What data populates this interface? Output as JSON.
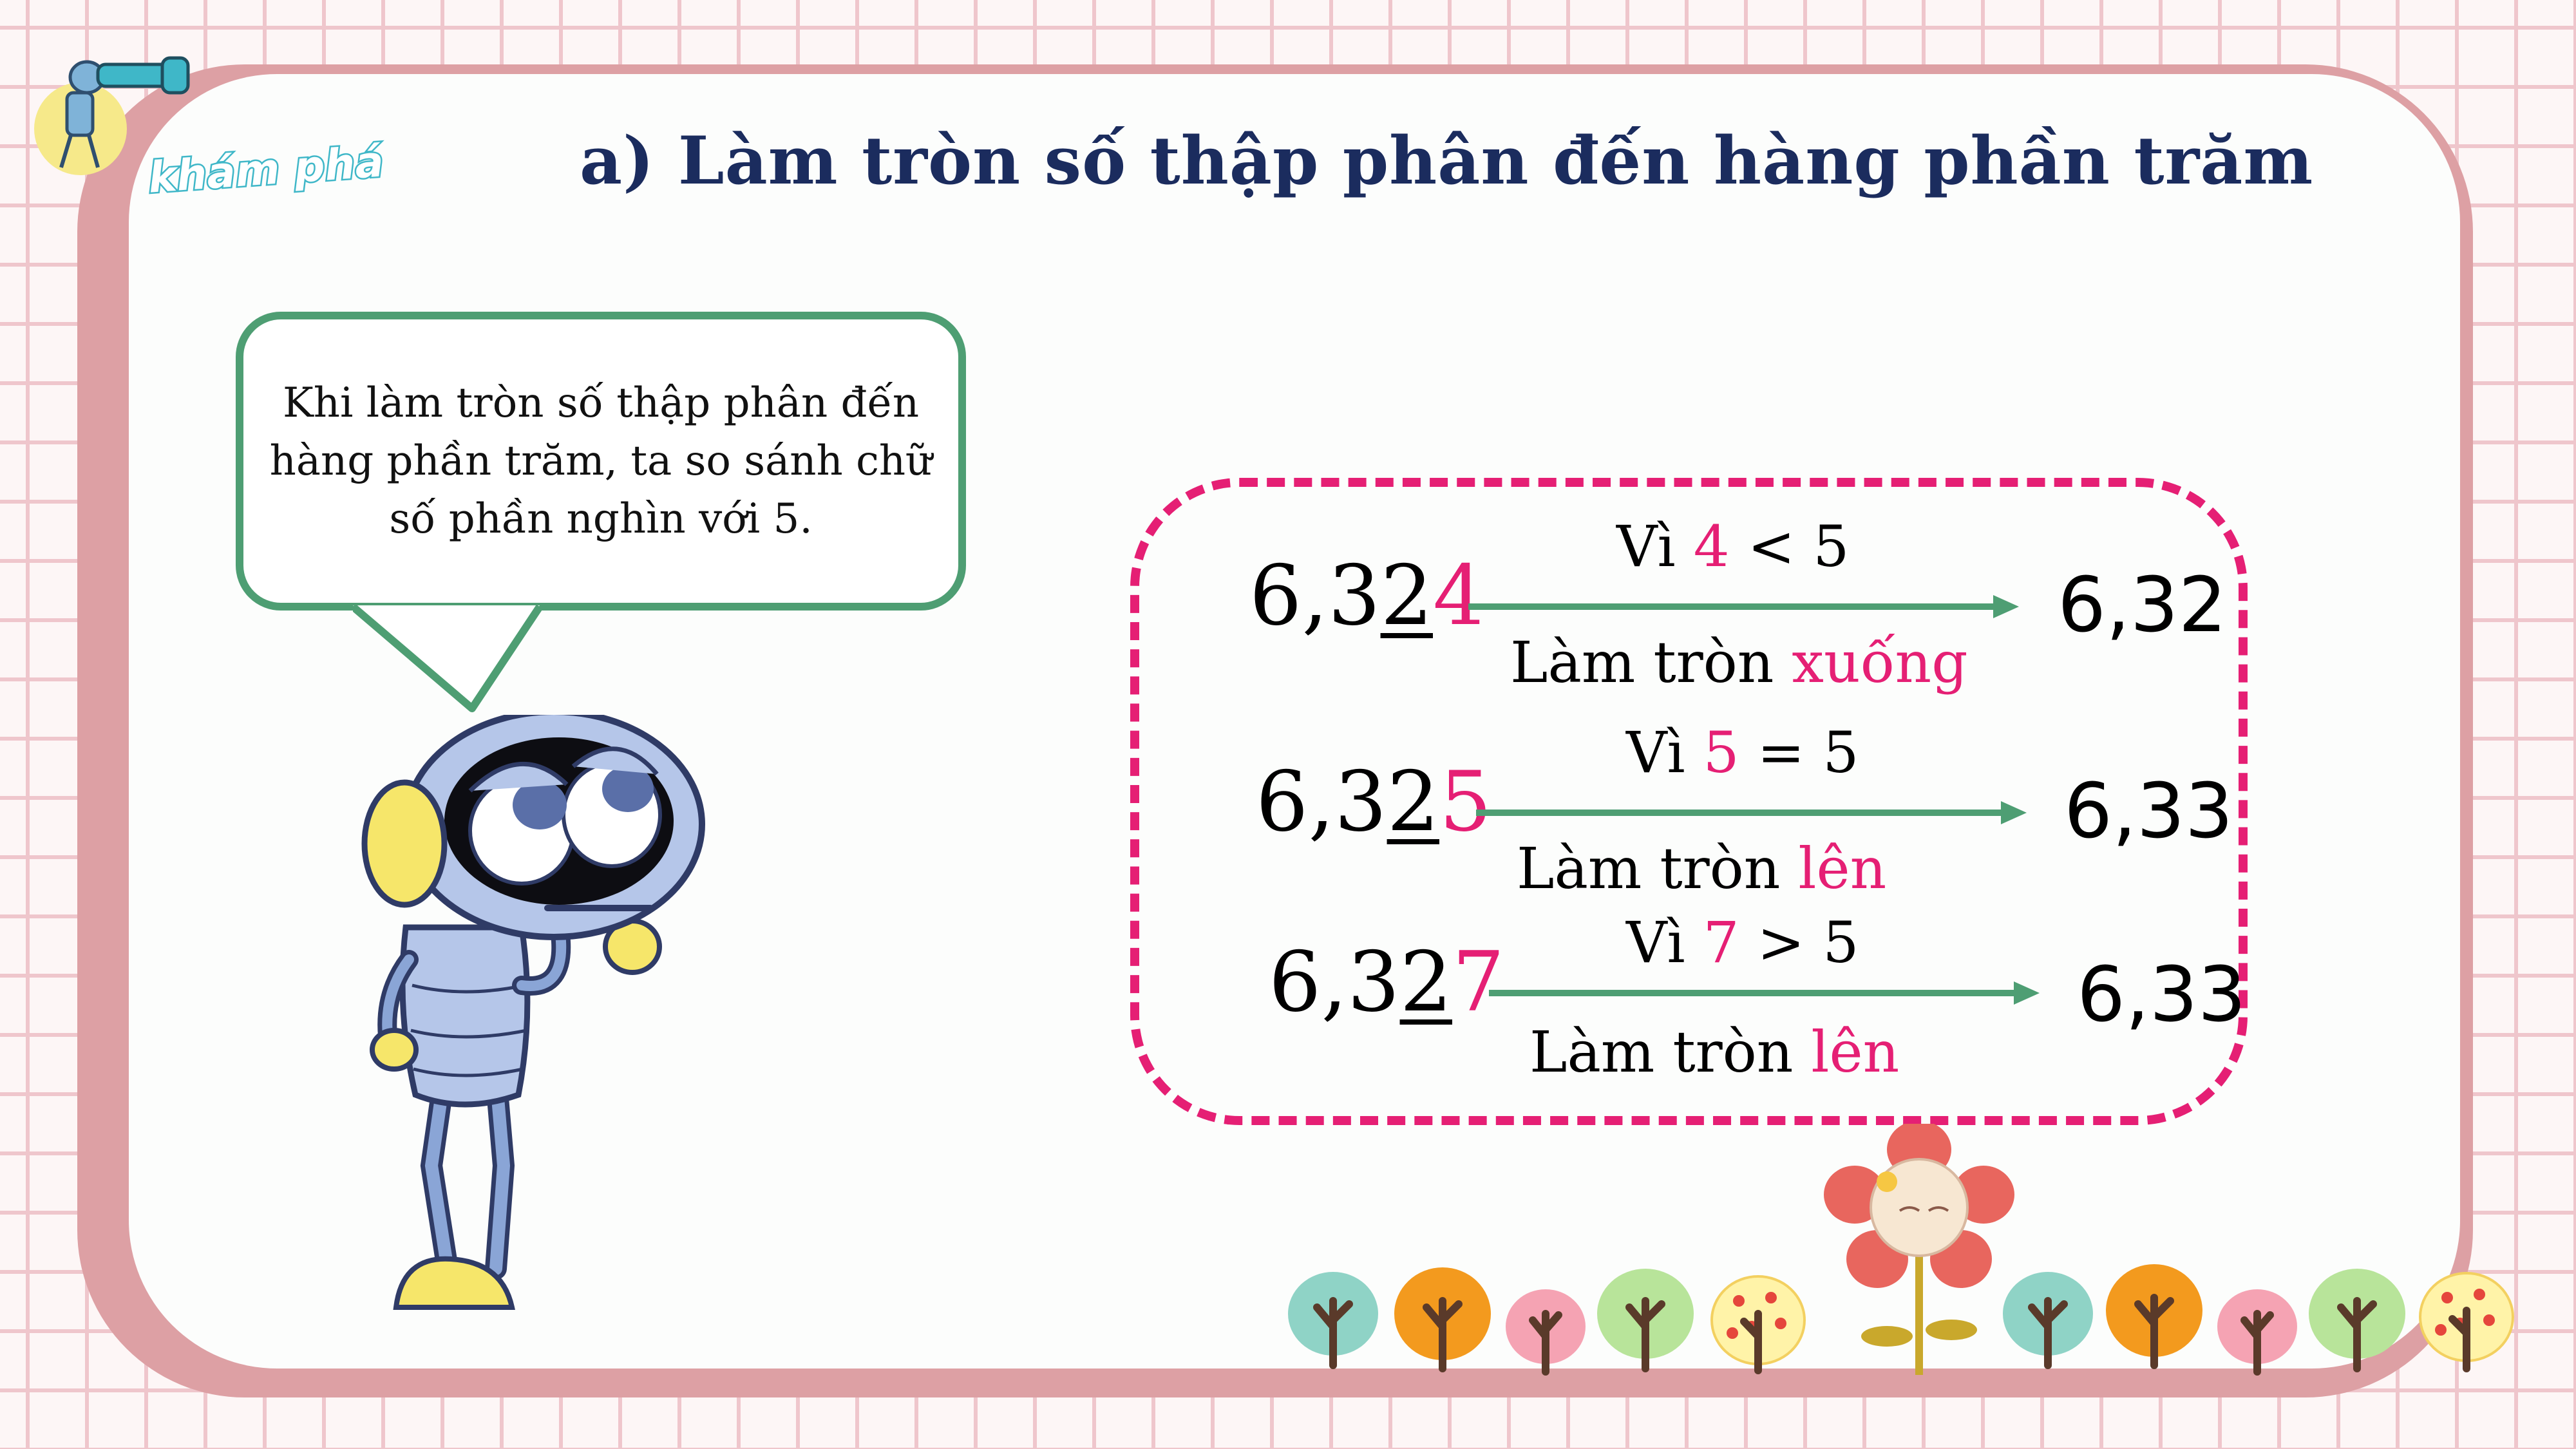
{
  "badge": {
    "label": "khám phá"
  },
  "title": "a) Làm tròn số thập phân đến hàng phần trăm",
  "bubble": {
    "text": "Khi làm tròn số thập phân đến hàng phần trăm, ta so sánh chữ số phần nghìn với 5."
  },
  "colors": {
    "accent": "#e51f74",
    "arrow": "#4e9e73",
    "title": "#1b2c5e"
  },
  "rows": [
    {
      "number_head": "6,3",
      "number_hundredths": "2",
      "number_thousandths": "4",
      "reason_prefix": "Vì ",
      "reason_digit": "4",
      "reason_suffix": " < 5",
      "action_prefix": "Làm tròn ",
      "action_word": "xuống",
      "result": "6,32"
    },
    {
      "number_head": "6,3",
      "number_hundredths": "2",
      "number_thousandths": "5",
      "reason_prefix": "Vì ",
      "reason_digit": "5",
      "reason_suffix": " = 5",
      "action_prefix": "Làm tròn ",
      "action_word": "lên",
      "result": "6,33"
    },
    {
      "number_head": "6,3",
      "number_hundredths": "2",
      "number_thousandths": "7",
      "reason_prefix": "Vì ",
      "reason_digit": "7",
      "reason_suffix": " > 5",
      "action_prefix": "Làm tròn ",
      "action_word": "lên",
      "result": "6,33"
    }
  ]
}
